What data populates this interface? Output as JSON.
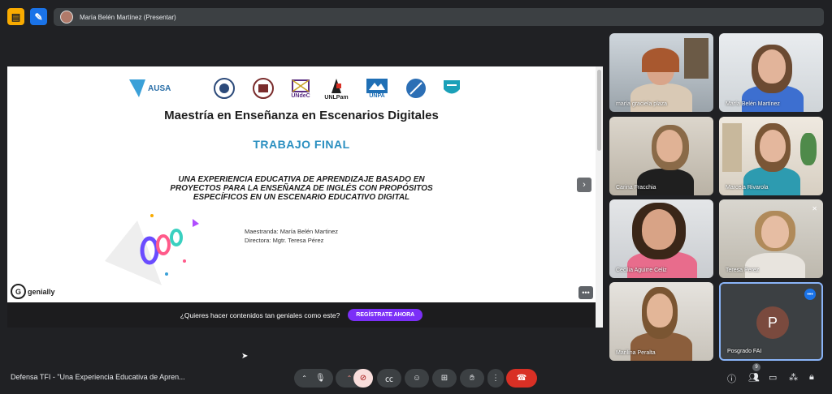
{
  "presenter": {
    "label": "María Belén Martínez (Presentar)"
  },
  "slide": {
    "logos": [
      "AUSA",
      "UNdeC",
      "UNLPam",
      "UNPA"
    ],
    "title": "Maestría en Enseñanza en Escenarios Digitales",
    "subtitle": "TRABAJO FINAL",
    "thesis": "UNA EXPERIENCIA EDUCATIVA DE APRENDIZAJE BASADO EN PROYECTOS PARA LA ENSEÑANZA DE INGLÉS CON PROPÓSITOS ESPECÍFICOS EN UN ESCENARIO EDUCATIVO DIGITAL",
    "author": "Maestranda: María Belén Martinez",
    "director": "Directora: Mgtr. Teresa Pérez",
    "brand": "genially",
    "next_glyph": "›",
    "more_glyph": "•••"
  },
  "promo": {
    "text": "¿Quieres hacer contenidos tan geniales como este?",
    "button": "REGÍSTRATE AHORA"
  },
  "participants": [
    {
      "name": "maría graciela plaza"
    },
    {
      "name": "María Belén Martínez"
    },
    {
      "name": "Carina Fracchia"
    },
    {
      "name": "Marcela Rivarola"
    },
    {
      "name": "Cecilia Aguirre Celiz"
    },
    {
      "name": "Teresa Perez"
    },
    {
      "name": "Marilina Peralta"
    },
    {
      "name": "Posgrado FAI",
      "initial": "P"
    }
  ],
  "meeting": {
    "title": "Defensa TFI - \"Una Experiencia Educativa de Apren...",
    "participant_count": "9"
  },
  "colors": {
    "accent": "#1a73e8",
    "hangup": "#d93025",
    "promo_button": "#7b2ff7",
    "subtitle": "#2a8fc0"
  }
}
